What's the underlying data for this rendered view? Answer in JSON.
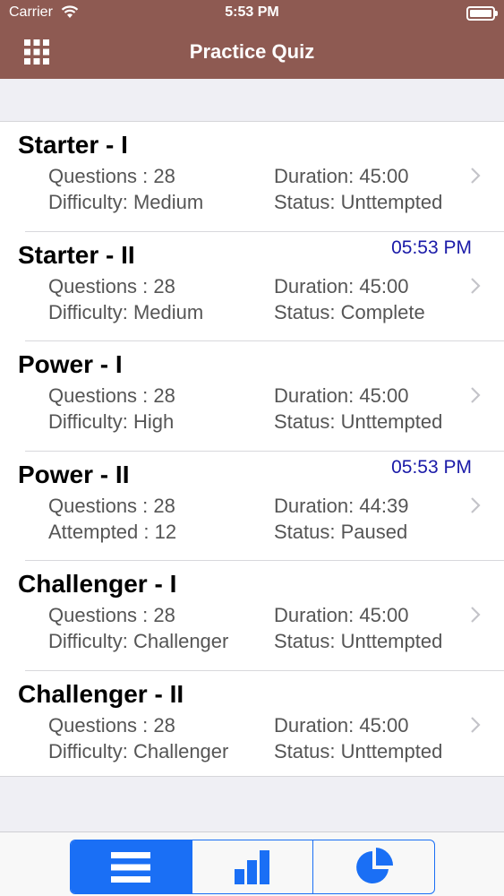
{
  "status_bar": {
    "carrier": "Carrier",
    "time": "5:53 PM"
  },
  "navbar": {
    "title": "Practice Quiz",
    "menu_icon": "grid-menu-icon"
  },
  "quizzes": [
    {
      "name": "Starter - I",
      "left1": "Questions : 28",
      "left2": "Difficulty: Medium",
      "right1": "Duration: 45:00",
      "right2": "Status: Unttempted",
      "timestamp": ""
    },
    {
      "name": "Starter - II",
      "left1": "Questions : 28",
      "left2": "Difficulty: Medium",
      "right1": "Duration: 45:00",
      "right2": "Status: Complete",
      "timestamp": "05:53 PM"
    },
    {
      "name": "Power - I",
      "left1": "Questions : 28",
      "left2": "Difficulty: High",
      "right1": "Duration: 45:00",
      "right2": "Status: Unttempted",
      "timestamp": ""
    },
    {
      "name": "Power - II",
      "left1": "Questions : 28",
      "left2": "Attempted : 12",
      "right1": "Duration: 44:39",
      "right2": "Status: Paused",
      "timestamp": "05:53 PM"
    },
    {
      "name": "Challenger - I",
      "left1": "Questions : 28",
      "left2": "Difficulty: Challenger",
      "right1": "Duration: 45:00",
      "right2": "Status: Unttempted",
      "timestamp": ""
    },
    {
      "name": "Challenger - II",
      "left1": "Questions : 28",
      "left2": "Difficulty: Challenger",
      "right1": "Duration: 45:00",
      "right2": "Status: Unttempted",
      "timestamp": ""
    }
  ],
  "tabs": [
    {
      "icon": "list-icon",
      "selected": true
    },
    {
      "icon": "bar-chart-icon",
      "selected": false
    },
    {
      "icon": "pie-chart-icon",
      "selected": false
    }
  ],
  "colors": {
    "nav_background": "#8e5a52",
    "accent": "#1a6ff5",
    "timestamp": "#1a1aa8"
  }
}
